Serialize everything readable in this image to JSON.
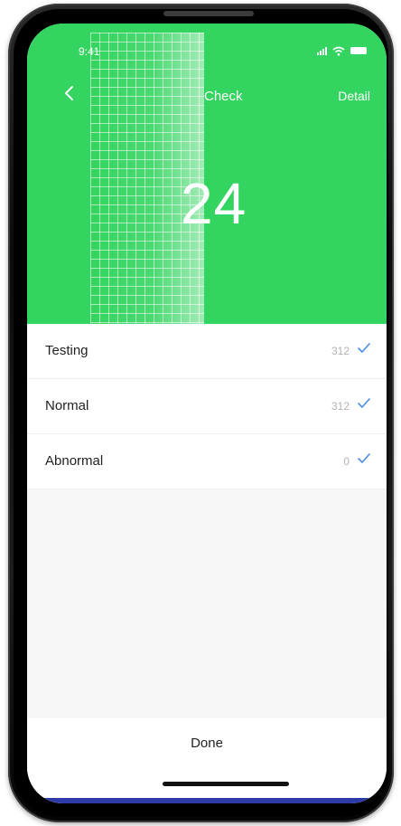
{
  "status_bar": {
    "time": "9:41"
  },
  "nav": {
    "title": "Check",
    "detail_label": "Detail"
  },
  "hero": {
    "count": "24",
    "accent_color": "#33d45f"
  },
  "items": [
    {
      "label": "Testing",
      "count": "312",
      "checked": true
    },
    {
      "label": "Normal",
      "count": "312",
      "checked": true
    },
    {
      "label": "Abnormal",
      "count": "0",
      "checked": true
    }
  ],
  "footer": {
    "done_label": "Done"
  },
  "icons": {
    "back": "chevron-left-icon",
    "check": "checkmark-icon",
    "signal": "signal-icon",
    "wifi": "wifi-icon",
    "battery": "battery-icon"
  },
  "colors": {
    "check": "#4a8ee8",
    "count_text": "#b3b3b3"
  }
}
